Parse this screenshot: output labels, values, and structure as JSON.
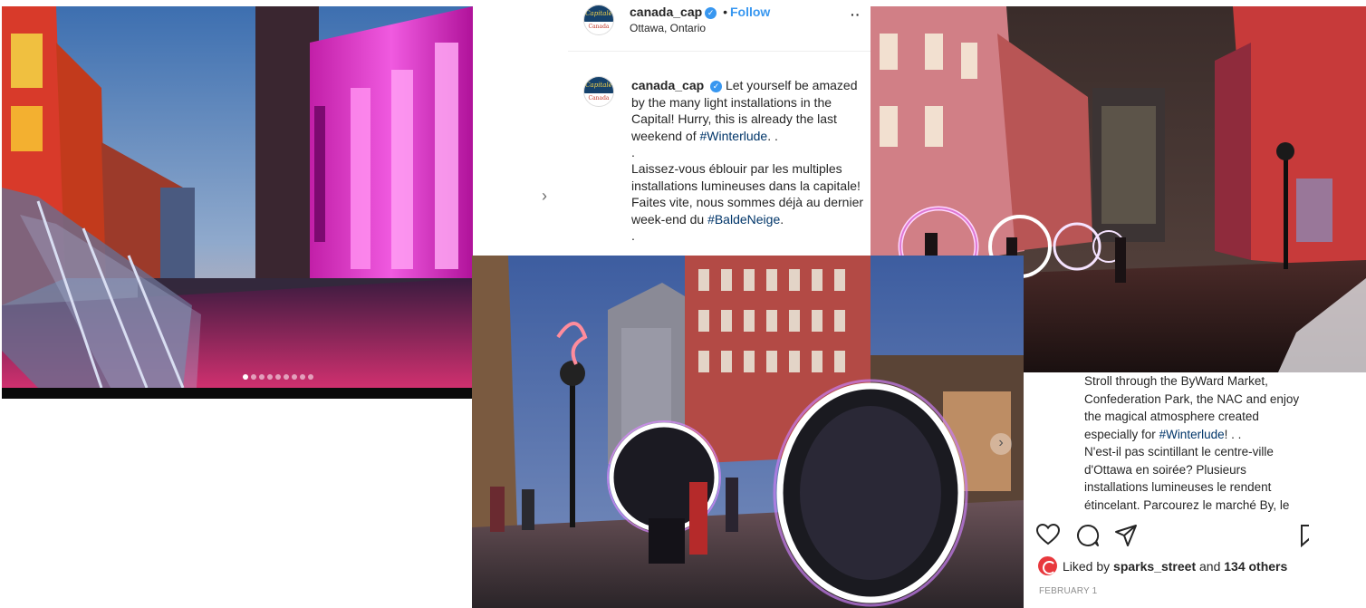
{
  "post": {
    "username": "canada_cap",
    "follow_label": "Follow",
    "bullet": "•",
    "location": "Ottawa, Ontario",
    "more_label": "··",
    "avatar_line1": "Capitale",
    "avatar_line2": "Canada",
    "verified_mark": "✓"
  },
  "caption": {
    "line1_text": "Let yourself be amazed by the many light installations in the Capital! Hurry, this is already the last weekend of",
    "line1_tag": "#Winterlude",
    "line1_end": ". .",
    "dot_line": ".",
    "line2_text": "Laissez-vous éblouir par les multiples installations lumineuses dans la capitale! Faites vite, nous sommes déjà au dernier week-end du",
    "line2_tag": "#BaldeNeige",
    "line2_end": ".",
    "trailing_dot": "."
  },
  "caption2": {
    "text1": "Stroll through the ByWard Market, Confederation Park, the NAC and enjoy the magical atmosphere created especially for",
    "tag": "#Winterlude",
    "text1_end": "! . .",
    "text2": "N'est-il pas scintillant le centre-ville d'Ottawa en soirée? Plusieurs installations lumineuses le rendent étincelant. Parcourez le marché By, le"
  },
  "likes": {
    "prefix": "Liked by",
    "liker": "sparks_street",
    "and": "and",
    "others": "134 others"
  },
  "date": "FEBRUARY 1",
  "carousel": {
    "dot_count": 9,
    "active_index": 0,
    "next_glyph": "›"
  },
  "colors": {
    "link": "#3897f0",
    "hashtag": "#003569",
    "text": "#262626",
    "muted": "#8e8e8e",
    "like_avatar": "#e8383d"
  }
}
